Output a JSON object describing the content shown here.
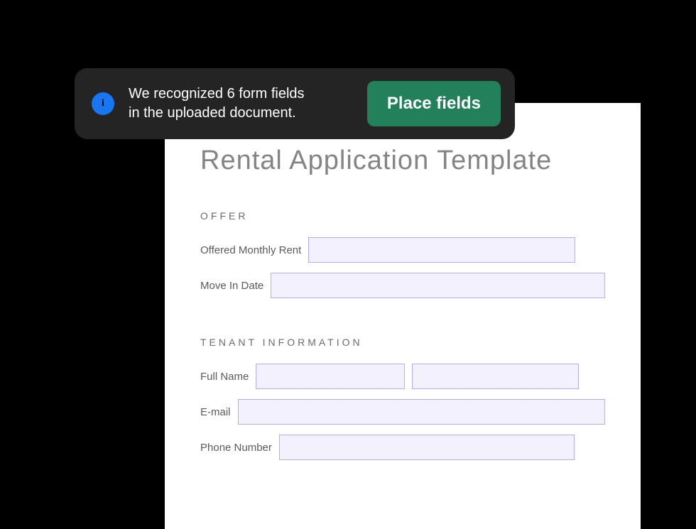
{
  "toast": {
    "message_line1": "We recognized 6 form fields",
    "message_line2": "in the uploaded document.",
    "button_label": "Place fields",
    "info_glyph": "i"
  },
  "document": {
    "title": "Rental Application Template",
    "sections": {
      "offer": {
        "heading": "OFFER",
        "fields": {
          "rent_label": "Offered Monthly Rent",
          "movein_label": "Move In Date"
        }
      },
      "tenant": {
        "heading": "TENANT INFORMATION",
        "fields": {
          "fullname_label": "Full Name",
          "email_label": "E-mail",
          "phone_label": "Phone Number"
        }
      }
    }
  }
}
